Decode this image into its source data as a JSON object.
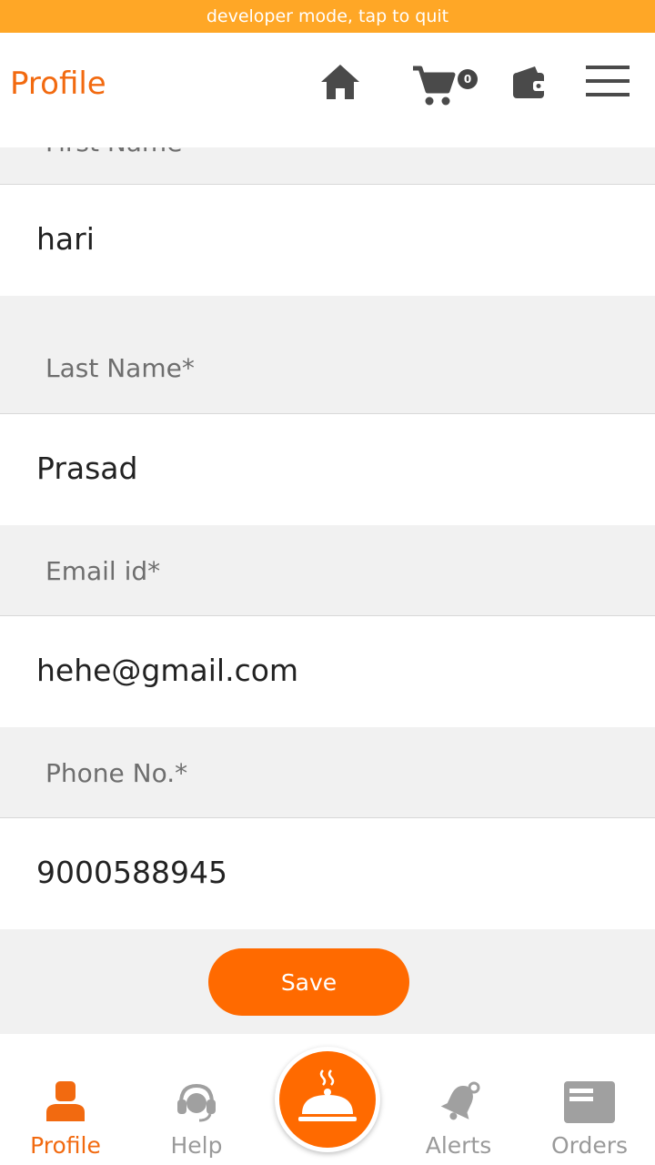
{
  "status_bar": {
    "text": "developer mode, tap to quit"
  },
  "header": {
    "title": "Profile",
    "cart_count": "0"
  },
  "form": {
    "partial_label": "First Name",
    "first_name_value": "hari",
    "last_name_label": "Last Name*",
    "last_name_value": "Prasad",
    "email_label": "Email id*",
    "email_value": "hehe@gmail.com",
    "phone_label": "Phone No.*",
    "phone_value": "9000588945",
    "save_label": "Save"
  },
  "bottom_nav": {
    "profile": "Profile",
    "help": "Help",
    "alerts": "Alerts",
    "orders": "Orders"
  },
  "colors": {
    "accent": "#ff6a00",
    "title": "#f26a10",
    "devbar": "#ffa726",
    "icon": "#4a4a4a"
  }
}
